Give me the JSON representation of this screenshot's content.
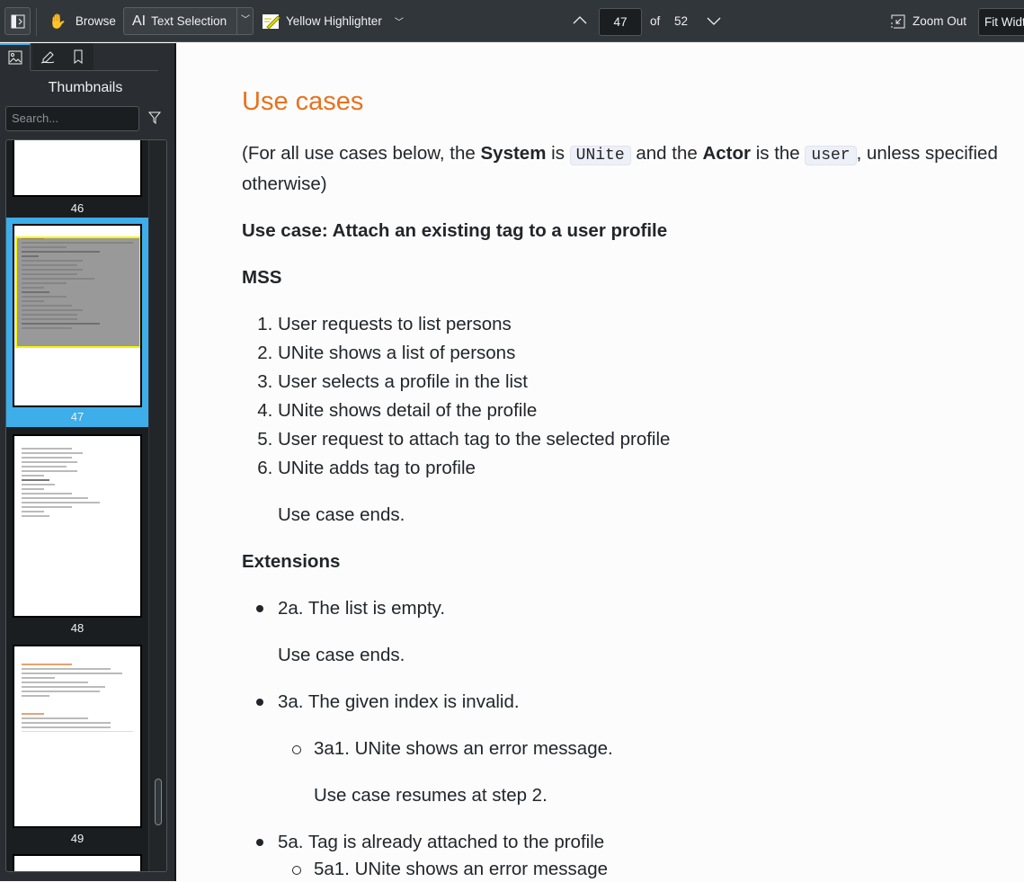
{
  "toolbar": {
    "browse": "Browse",
    "text_selection": "Text Selection",
    "highlighter": "Yellow Highlighter",
    "page_current": "47",
    "of": "of",
    "page_total": "52",
    "zoom_out": "Zoom Out",
    "fit": "Fit Width"
  },
  "sidebar": {
    "title": "Thumbnails",
    "search_placeholder": "Search...",
    "thumbnails": [
      {
        "n": "46"
      },
      {
        "n": "47"
      },
      {
        "n": "48"
      },
      {
        "n": "49"
      }
    ]
  },
  "doc": {
    "heading": "Use cases",
    "intro": {
      "p1": "(For all use cases below, the ",
      "system": "System",
      "p2": " is ",
      "unite": "UNite",
      "p3": " and the ",
      "actor": "Actor",
      "p4": " is the ",
      "user": "user",
      "p5": ", unless specified",
      "p6": "otherwise)"
    },
    "uc_title": "Use case: Attach an existing tag to a user profile",
    "mss": "MSS",
    "steps": [
      "User requests to list persons",
      "UNite shows a list of persons",
      "User selects a profile in the list",
      "UNite shows detail of the profile",
      "User request to attach tag to the selected profile",
      "UNite adds tag to profile"
    ],
    "ends": "Use case ends.",
    "extensions": "Extensions",
    "ext": {
      "e2a": "2a. The list is empty.",
      "e2a_end": "Use case ends.",
      "e3a": "3a. The given index is invalid.",
      "e3a1": "3a1. UNite shows an error message.",
      "e3a1_end": "Use case resumes at step 2.",
      "e5a": "5a. Tag is already attached to the profile",
      "e5a1": "5a1. UNite shows an error message"
    }
  }
}
